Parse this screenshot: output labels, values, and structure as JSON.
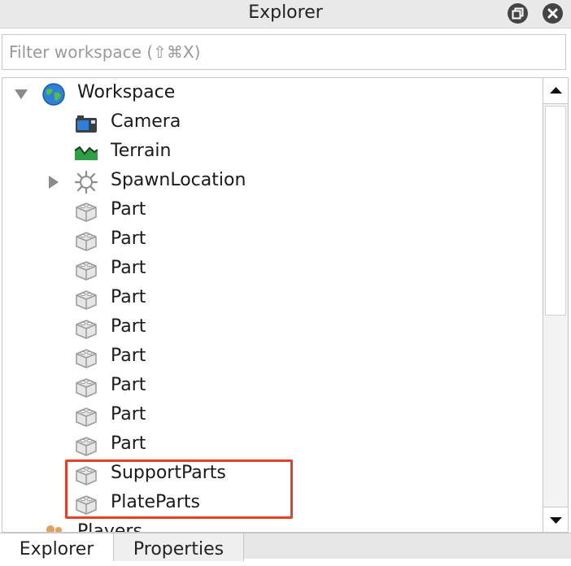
{
  "window": {
    "title": "Explorer"
  },
  "filter": {
    "placeholder": "Filter workspace (⇧⌘X)"
  },
  "tree": {
    "rows": [
      {
        "label": "Workspace"
      },
      {
        "label": "Camera"
      },
      {
        "label": "Terrain"
      },
      {
        "label": "SpawnLocation"
      },
      {
        "label": "Part"
      },
      {
        "label": "Part"
      },
      {
        "label": "Part"
      },
      {
        "label": "Part"
      },
      {
        "label": "Part"
      },
      {
        "label": "Part"
      },
      {
        "label": "Part"
      },
      {
        "label": "Part"
      },
      {
        "label": "Part"
      },
      {
        "label": "SupportParts"
      },
      {
        "label": "PlateParts"
      },
      {
        "label": "Players"
      }
    ]
  },
  "tabs": [
    {
      "label": "Explorer"
    },
    {
      "label": "Properties"
    }
  ],
  "colors": {
    "highlight": "#e4412b",
    "terrain": "#2f9e44",
    "globe": "#2f7fd6"
  },
  "icons": {
    "workspace": "globe-icon",
    "camera": "camera-icon",
    "terrain": "terrain-icon",
    "spawn": "spawn-location-icon",
    "part": "part-brick-icon",
    "players": "players-icon"
  }
}
